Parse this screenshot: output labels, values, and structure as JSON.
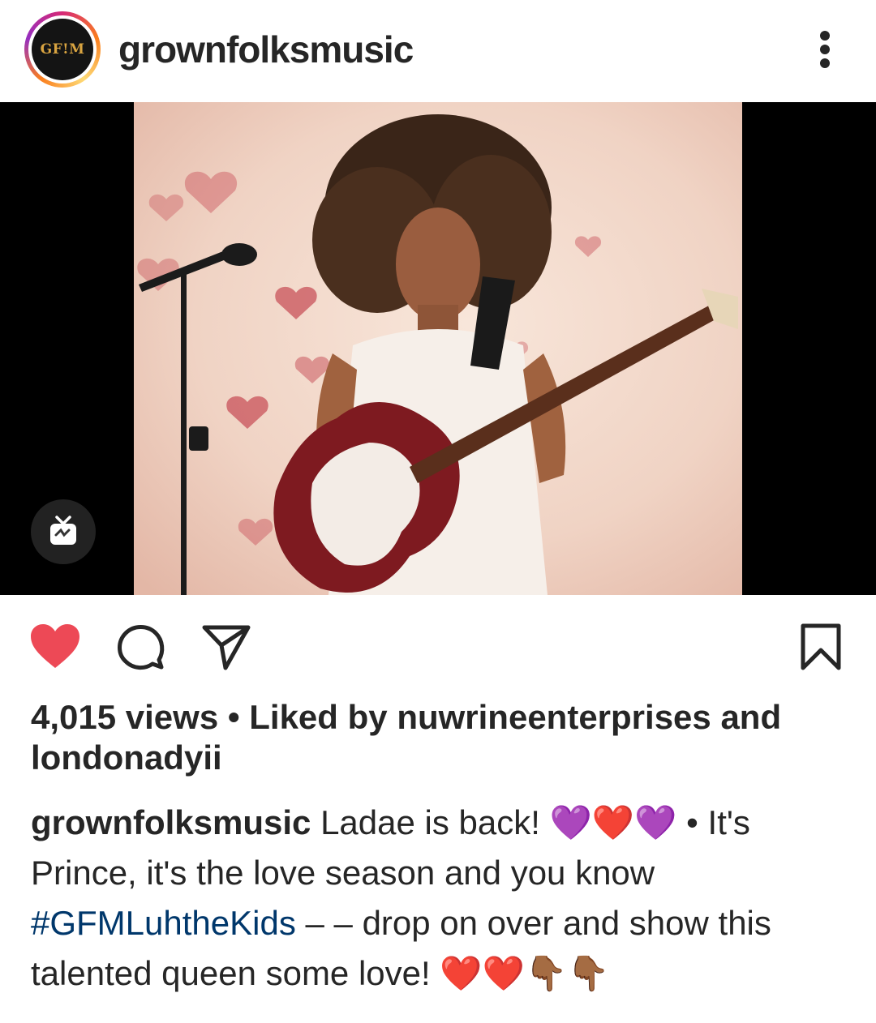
{
  "header": {
    "username": "grownfolksmusic",
    "avatar_text": "GF!M",
    "more_icon": "more-vertical-icon"
  },
  "media": {
    "type": "igtv-video",
    "badge_icon": "igtv-icon"
  },
  "actions": {
    "like_icon": "heart-filled-icon",
    "like_color": "#ed4956",
    "comment_icon": "comment-icon",
    "share_icon": "send-icon",
    "save_icon": "bookmark-icon"
  },
  "meta": {
    "views": "4,015 views",
    "separator": "•",
    "liked_by_prefix": "Liked by",
    "liked_user": "nuwrineenterprises",
    "and": "and",
    "other_user": "londonadyii"
  },
  "caption": {
    "username": "grownfolksmusic",
    "text1": "Ladae is back!",
    "emoji1": "💜❤️💜",
    "text2": "• It's Prince, it's the love season and you know",
    "hashtag": "#GFMLuhtheKids",
    "text3": "– – drop on over and show this talented queen  some love!",
    "emoji2": "❤️❤️👇🏾👇🏾",
    "hashtag_color": "#00376b"
  }
}
